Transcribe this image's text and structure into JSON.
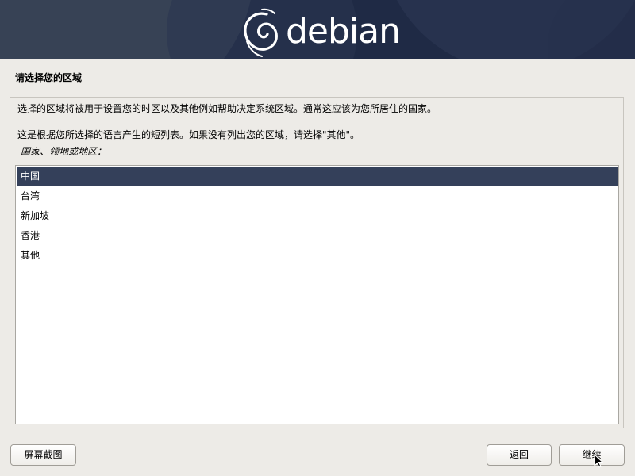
{
  "banner": {
    "logo_text": "debian",
    "logo_icon": "debian-swirl-icon",
    "background_color": "#1f2a45"
  },
  "page": {
    "title": "请选择您的区域"
  },
  "content": {
    "description_1": "选择的区域将被用于设置您的时区以及其他例如帮助决定系统区域。通常这应该为您所居住的国家。",
    "description_2": "这是根据您所选择的语言产生的短列表。如果没有列出您的区域，请选择\"其他\"。",
    "list_label": "国家、领地或地区："
  },
  "list": {
    "items": [
      {
        "label": "中国",
        "selected": true
      },
      {
        "label": "台湾",
        "selected": false
      },
      {
        "label": "新加坡",
        "selected": false
      },
      {
        "label": "香港",
        "selected": false
      },
      {
        "label": "其他",
        "selected": false
      }
    ],
    "selection_color": "#34405a"
  },
  "buttons": {
    "screenshot": "屏幕截图",
    "back": "返回",
    "continue": "继续"
  }
}
